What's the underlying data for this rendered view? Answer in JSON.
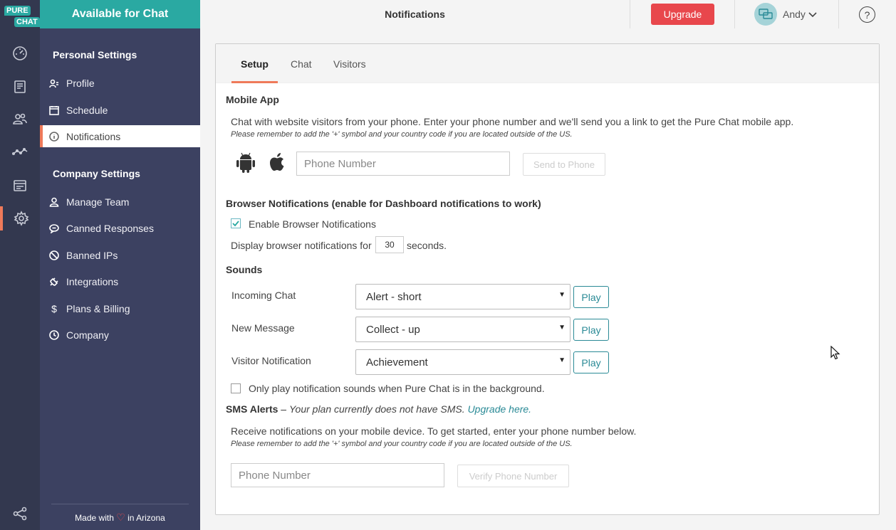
{
  "brand": {
    "logo_top": "PURE",
    "logo_bottom": "CHAT",
    "accent": "#2aa9a2",
    "highlight": "#ef7a5a"
  },
  "rail": [
    "dashboard-icon",
    "transcripts-icon",
    "contacts-icon",
    "analytics-icon",
    "widgets-icon",
    "settings-icon",
    "share-icon"
  ],
  "sidebar": {
    "status": "Available for Chat",
    "personal_heading": "Personal Settings",
    "personal_items": [
      {
        "label": "Profile",
        "icon": "profile-icon"
      },
      {
        "label": "Schedule",
        "icon": "calendar-icon"
      },
      {
        "label": "Notifications",
        "icon": "info-icon",
        "active": true
      }
    ],
    "company_heading": "Company Settings",
    "company_items": [
      {
        "label": "Manage Team",
        "icon": "user-icon"
      },
      {
        "label": "Canned Responses",
        "icon": "chat-bubble-icon"
      },
      {
        "label": "Banned IPs",
        "icon": "ban-icon"
      },
      {
        "label": "Integrations",
        "icon": "plug-icon"
      },
      {
        "label": "Plans & Billing",
        "icon": "dollar-icon"
      },
      {
        "label": "Company",
        "icon": "clock-icon"
      }
    ],
    "footer_prefix": "Made with",
    "footer_suffix": "in Arizona"
  },
  "topbar": {
    "title": "Notifications",
    "upgrade": "Upgrade",
    "user": "Andy",
    "help": "?"
  },
  "tabs": [
    "Setup",
    "Chat",
    "Visitors"
  ],
  "mobile_app": {
    "title": "Mobile App",
    "description": "Chat with website visitors from your phone. Enter your phone number and we'll send you a link to get the Pure Chat mobile app.",
    "note": "Please remember to add the '+' symbol and your country code if you are located outside of the US.",
    "phone_placeholder": "Phone Number",
    "send_button": "Send to Phone"
  },
  "browser_notifications": {
    "title": "Browser Notifications (enable for Dashboard notifications to work)",
    "enable_label": "Enable Browser Notifications",
    "enabled": true,
    "display_prefix": "Display browser notifications for",
    "seconds_value": "30",
    "display_suffix": "seconds."
  },
  "sounds": {
    "title": "Sounds",
    "rows": [
      {
        "label": "Incoming Chat",
        "value": "Alert - short",
        "play": "Play"
      },
      {
        "label": "New Message",
        "value": "Collect - up",
        "play": "Play"
      },
      {
        "label": "Visitor Notification",
        "value": "Achievement",
        "play": "Play"
      }
    ],
    "background_only_label": "Only play notification sounds when Pure Chat is in the background.",
    "background_only": false
  },
  "sms": {
    "title": "SMS Alerts",
    "dash": " – ",
    "plan_note": "Your plan currently does not have SMS.",
    "upgrade_link": "Upgrade here.",
    "description": "Receive notifications on your mobile device. To get started, enter your phone number below.",
    "note": "Please remember to add the '+' symbol and your country code if you are located outside of the US.",
    "phone_placeholder": "Phone Number",
    "verify_button": "Verify Phone Number"
  }
}
